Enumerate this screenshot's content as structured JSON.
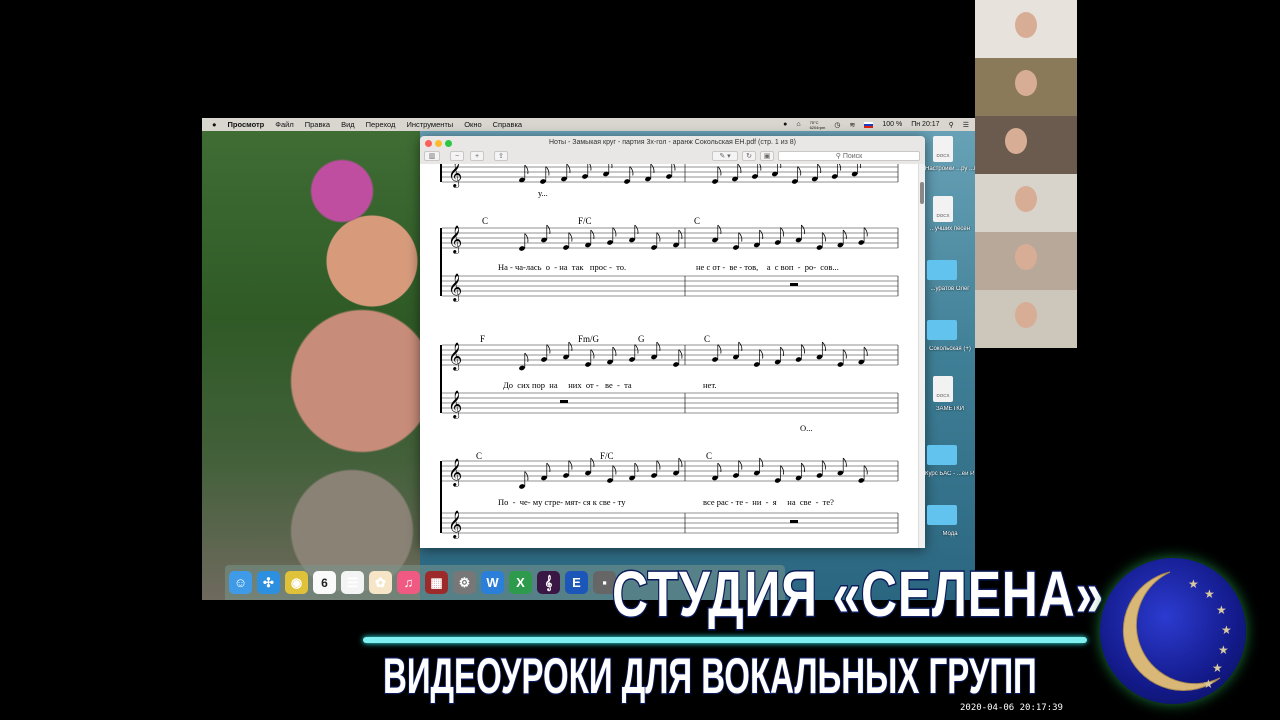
{
  "menubar": {
    "app": "Просмотр",
    "items": [
      "Файл",
      "Правка",
      "Вид",
      "Переход",
      "Инструменты",
      "Окно",
      "Справка"
    ],
    "weather_temp": "75°C",
    "weather_sub": "6204rpm",
    "battery": "100 %",
    "clock": "Пн 20:17"
  },
  "window": {
    "title": "Ноты - Замыкая круг - партия 3х-гол - аранж Сокольская ЕН.pdf (стр. 1 из 8)",
    "search_placeholder": "Поиск"
  },
  "score": {
    "systems": [
      {
        "chords": [],
        "lyrics": [
          "у..."
        ],
        "lyrics2": []
      },
      {
        "chords": [
          "C",
          "F/C",
          "C"
        ],
        "lyrics": [
          "На - ча-лась  о  - на  так   прос -  то.",
          "не с от -  ве - тов,    а  с воп  -  ро-  сов..."
        ],
        "lyrics2": []
      },
      {
        "chords": [
          "F",
          "Fm/G",
          "G",
          "C"
        ],
        "lyrics": [
          "До  сих пор  на     них  от -   ве  -  та",
          "нет."
        ],
        "lyrics2": [
          "О..."
        ]
      },
      {
        "chords": [
          "C",
          "F/C",
          "C"
        ],
        "lyrics": [
          "По  -  че- му стре- мят- ся к све - ту",
          "все рас - те -  ни  -  я     на  све  -  те?"
        ],
        "lyrics2": []
      }
    ]
  },
  "desktop": {
    "items": [
      {
        "label": "Настройки ...ру ...ЕВ.docx",
        "type": "docx"
      },
      {
        "label": "...учших песен",
        "type": "docx"
      },
      {
        "label": "...уратов Олег",
        "type": "folder"
      },
      {
        "label": "Сокольская (+)",
        "type": "folder"
      },
      {
        "label": "ЗАМЕТКИ",
        "type": "docx"
      },
      {
        "label": "Курс БАС - ...ей Р...ежский",
        "type": "folder"
      },
      {
        "label": "Мода",
        "type": "folder"
      }
    ],
    "docx_tag": "DOCX"
  },
  "dock": {
    "apps": [
      "finder",
      "safari",
      "chrome",
      "calendar",
      "reminders",
      "photos",
      "music",
      "photo-booth",
      "system-preferences",
      "word",
      "excel",
      "sibelius",
      "e-app",
      "other"
    ],
    "calendar_day": "6"
  },
  "banner": {
    "title": "СТУДИЯ «СЕЛЕНА»",
    "subtitle": "ВИДЕОУРОКИ ДЛЯ ВОКАЛЬНЫХ ГРУПП",
    "timestamp": "2020-04-06  20:17:39",
    "accent_color": "#7ff0f0"
  }
}
